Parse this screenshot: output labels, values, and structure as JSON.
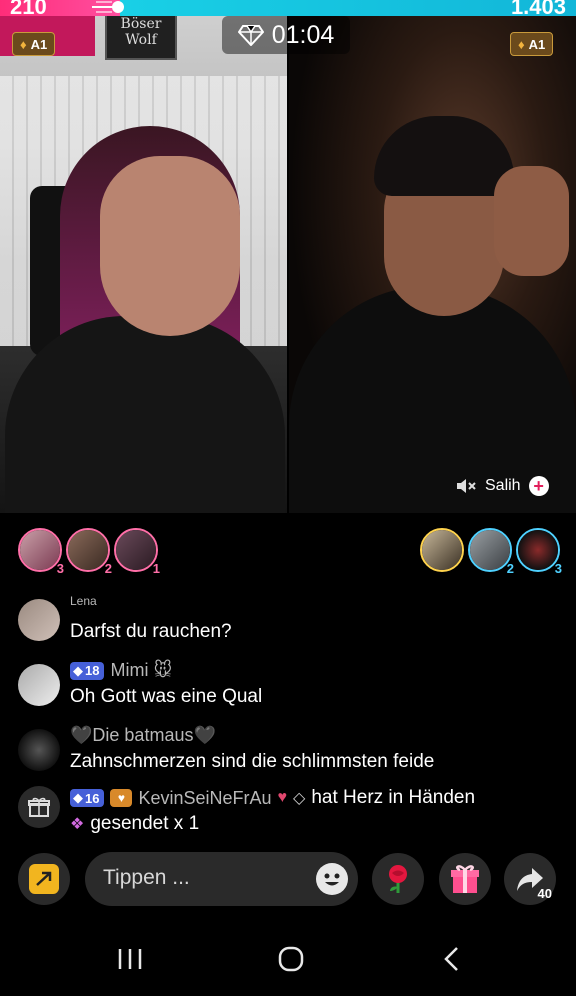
{
  "battle": {
    "left_score": "210",
    "right_score": "1.403",
    "timer": "01:04",
    "left_badge": "A1",
    "right_badge": "A1",
    "left_color": "#ff2d79",
    "right_color": "#19d0e6"
  },
  "left_stream": {
    "sign_text": "Böser Wolf"
  },
  "right_stream": {
    "host_name": "Salih",
    "muted_icon": "speaker-muted-icon"
  },
  "top_gifters": {
    "left": [
      {
        "rank": "3"
      },
      {
        "rank": "2"
      },
      {
        "rank": "1"
      }
    ],
    "right": [
      {
        "rank": ""
      },
      {
        "rank": "2"
      },
      {
        "rank": "3"
      }
    ]
  },
  "chat": [
    {
      "user": "Lena",
      "level": "",
      "text": "Darfst du rauchen?"
    },
    {
      "user": "Mimi 🐭",
      "level": "18",
      "text": "Oh Gott was eine Qual"
    },
    {
      "user": "🖤Die batmaus🖤",
      "level": "",
      "text": "Zahnschmerzen sind die schlimmsten feide"
    },
    {
      "user": "KevinSeiNeFrAu",
      "level": "16",
      "text": "hat Herz in Händen",
      "text2": "gesendet x 1"
    }
  ],
  "bottom_bar": {
    "input_placeholder": "Tippen ...",
    "share_count": "40"
  }
}
